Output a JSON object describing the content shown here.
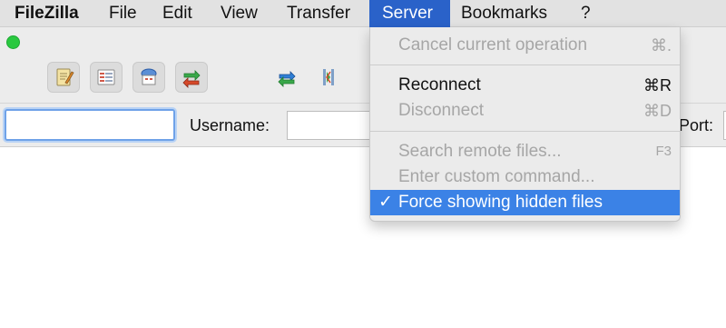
{
  "menubar": {
    "app_name": "FileZilla",
    "items": [
      "File",
      "Edit",
      "View",
      "Transfer",
      "Server",
      "Bookmarks",
      "?"
    ],
    "active_item": "Server"
  },
  "window": {
    "toolbar_icons": [
      "site-manager-icon",
      "toggle-message-log-icon",
      "toggle-remote-tree-icon",
      "toggle-transfer-queue-icon",
      "refresh-icon",
      "process-queue-icon"
    ]
  },
  "quickconnect": {
    "host_value": "",
    "username_label": "Username:",
    "username_value": "",
    "port_label": "Port:"
  },
  "server_menu": {
    "cancel": {
      "label": "Cancel current operation",
      "shortcut": "⌘."
    },
    "reconnect": {
      "label": "Reconnect",
      "shortcut": "⌘R"
    },
    "disconnect": {
      "label": "Disconnect",
      "shortcut": "⌘D"
    },
    "search": {
      "label": "Search remote files...",
      "shortcut": "F3"
    },
    "custom_command": {
      "label": "Enter custom command..."
    },
    "force_hidden": {
      "label": "Force showing hidden files",
      "checked": true,
      "check_mark": "✓"
    }
  },
  "colors": {
    "menu_highlight": "#2a62c9",
    "item_highlight": "#3b82e6",
    "traffic_green": "#2ac940"
  }
}
